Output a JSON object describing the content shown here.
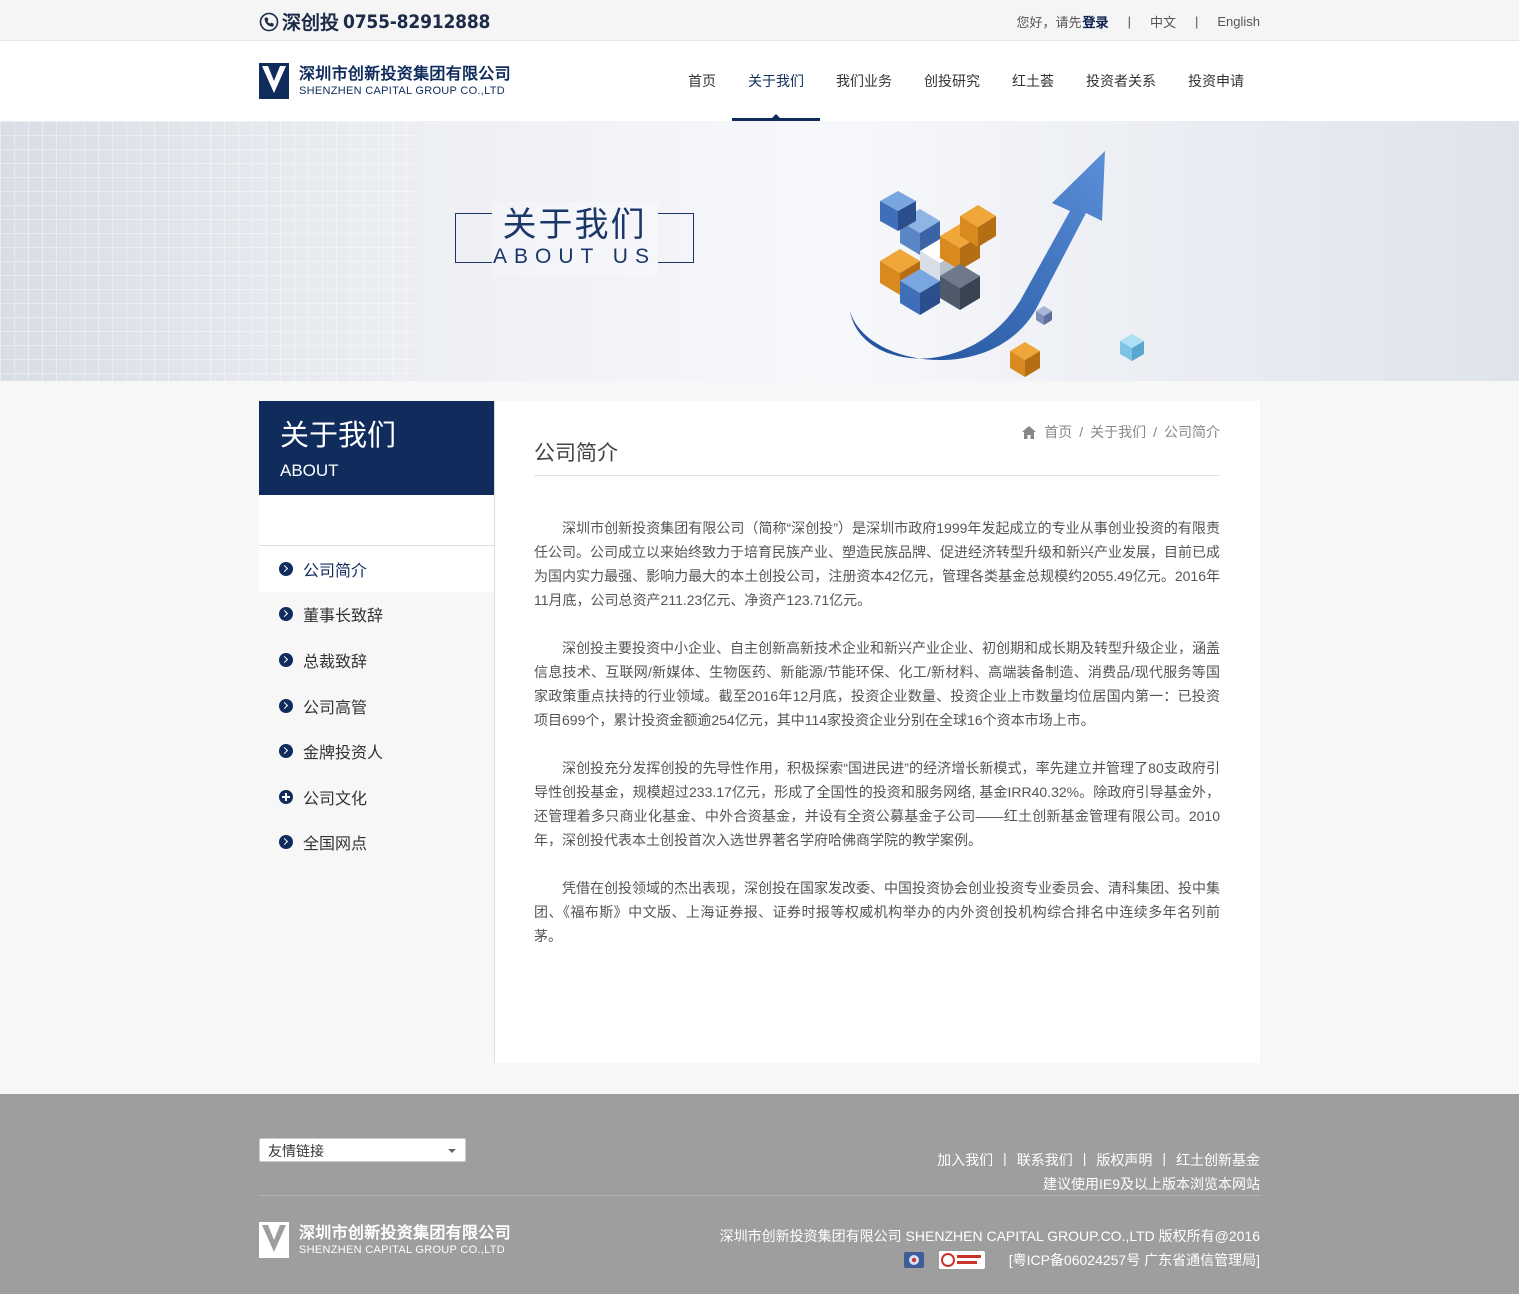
{
  "topbar": {
    "phone_label": "深创投",
    "phone_number": "0755-82912888",
    "greeting": "您好，请先",
    "login": "登录",
    "lang_cn": "中文",
    "lang_en": "English",
    "sep": "|"
  },
  "brand": {
    "name_cn": "深圳市创新投资集团有限公司",
    "name_en": "SHENZHEN CAPITAL GROUP CO.,LTD",
    "color": "#0f2c5d"
  },
  "nav": [
    {
      "label": "首页"
    },
    {
      "label": "关于我们",
      "active": true
    },
    {
      "label": "我们业务"
    },
    {
      "label": "创投研究"
    },
    {
      "label": "红土荟"
    },
    {
      "label": "投资者关系"
    },
    {
      "label": "投资申请"
    }
  ],
  "banner": {
    "title_cn": "关于我们",
    "title_en": "ABOUT US"
  },
  "sidebar": {
    "title_cn": "关于我们",
    "title_en": "ABOUT",
    "items": [
      {
        "label": "公司简介",
        "active": true,
        "icon": "chevron"
      },
      {
        "label": "董事长致辞",
        "icon": "chevron"
      },
      {
        "label": "总裁致辞",
        "icon": "chevron"
      },
      {
        "label": "公司高管",
        "icon": "chevron"
      },
      {
        "label": "金牌投资人",
        "icon": "chevron"
      },
      {
        "label": "公司文化",
        "icon": "plus"
      },
      {
        "label": "全国网点",
        "icon": "chevron"
      }
    ]
  },
  "breadcrumb": {
    "home": "首页",
    "parent": "关于我们",
    "current": "公司简介",
    "sep": "/"
  },
  "article": {
    "title": "公司简介",
    "paragraphs": [
      "深圳市创新投资集团有限公司（简称“深创投”）是深圳市政府1999年发起成立的专业从事创业投资的有限责任公司。公司成立以来始终致力于培育民族产业、塑造民族品牌、促进经济转型升级和新兴产业发展，目前已成为国内实力最强、影响力最大的本土创投公司，注册资本42亿元，管理各类基金总规模约2055.49亿元。2016年11月底，公司总资产211.23亿元、净资产123.71亿元。",
      "深创投主要投资中小企业、自主创新高新技术企业和新兴产业企业、初创期和成长期及转型升级企业，涵盖信息技术、互联网/新媒体、生物医药、新能源/节能环保、化工/新材料、高端装备制造、消费品/现代服务等国家政策重点扶持的行业领域。截至2016年12月底，投资企业数量、投资企业上市数量均位居国内第一：已投资项目699个，累计投资金额逾254亿元，其中114家投资企业分别在全球16个资本市场上市。",
      "深创投充分发挥创投的先导性作用，积极探索“国进民进”的经济增长新模式，率先建立并管理了80支政府引导性创投基金，规模超过233.17亿元，形成了全国性的投资和服务网络, 基金IRR40.32%。除政府引导基金外，还管理着多只商业化基金、中外合资基金，并设有全资公募基金子公司——红土创新基金管理有限公司。2010年，深创投代表本土创投首次入选世界著名学府哈佛商学院的教学案例。",
      "凭借在创投领域的杰出表现，深创投在国家发改委、中国投资协会创业投资专业委员会、清科集团、投中集团、《福布斯》中文版、上海证券报、证券时报等权威机构举办的内外资创投机构综合排名中连续多年名列前茅。"
    ]
  },
  "footer": {
    "select_label": "友情链接",
    "links": [
      "加入我们",
      "联系我们",
      "版权声明",
      "红土创新基金"
    ],
    "sep": "|",
    "browser_tip": "建议使用IE9及以上版本浏览本网站",
    "copyright": "深圳市创新投资集团有限公司 SHENZHEN CAPITAL GROUP.CO.,LTD 版权所有@2016",
    "icp": "[粤ICP备06024257号 广东省通信管理局]",
    "bg": "#9e9e9e"
  }
}
